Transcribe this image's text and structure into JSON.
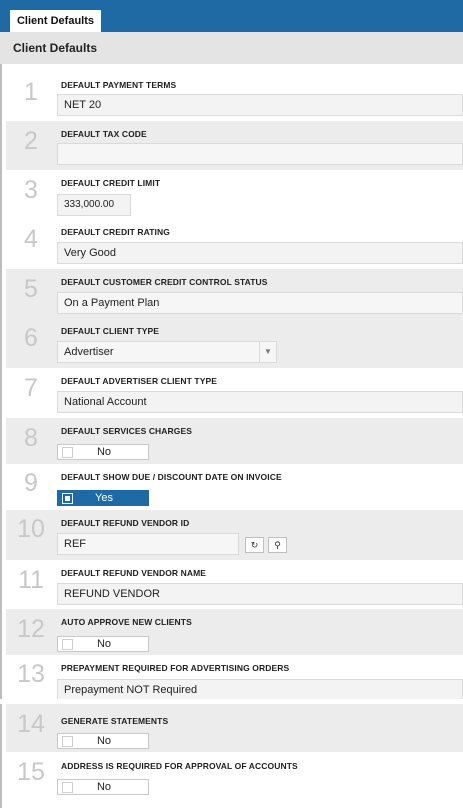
{
  "tab": {
    "label": "Client Defaults"
  },
  "header": {
    "title": "Client Defaults"
  },
  "rows": [
    {
      "number": "1",
      "label": "DEFAULT PAYMENT TERMS",
      "value": "NET 20"
    },
    {
      "number": "2",
      "label": "DEFAULT TAX CODE",
      "value": ""
    },
    {
      "number": "3",
      "label": "DEFAULT CREDIT LIMIT",
      "value": "333,000.00"
    },
    {
      "number": "4",
      "label": "DEFAULT CREDIT RATING",
      "value": "Very Good"
    },
    {
      "number": "5",
      "label": "DEFAULT CUSTOMER CREDIT CONTROL STATUS",
      "value": "On a Payment Plan"
    },
    {
      "number": "6",
      "label": "DEFAULT CLIENT TYPE",
      "value": "Advertiser"
    },
    {
      "number": "7",
      "label": "DEFAULT ADVERTISER CLIENT TYPE",
      "value": "National Account"
    },
    {
      "number": "8",
      "label": "DEFAULT SERVICES CHARGES",
      "value": "No"
    },
    {
      "number": "9",
      "label": "DEFAULT SHOW DUE / DISCOUNT DATE ON INVOICE",
      "value": "Yes"
    },
    {
      "number": "10",
      "label": "DEFAULT REFUND VENDOR ID",
      "value": "REF"
    },
    {
      "number": "11",
      "label": "DEFAULT REFUND VENDOR NAME",
      "value": "REFUND VENDOR"
    },
    {
      "number": "12",
      "label": "AUTO APPROVE NEW CLIENTS",
      "value": "No"
    },
    {
      "number": "13",
      "label": "PREPAYMENT REQUIRED FOR ADVERTISING ORDERS",
      "value": "Prepayment NOT Required"
    },
    {
      "number": "14",
      "label": "GENERATE STATEMENTS",
      "value": "No"
    },
    {
      "number": "15",
      "label": "ADDRESS IS REQUIRED FOR APPROVAL OF ACCOUNTS",
      "value": "No"
    }
  ],
  "icons": {
    "dropdown": "chevron-down-icon",
    "clear": "refresh-icon",
    "search": "search-icon"
  },
  "colors": {
    "accent": "#1f6aa5",
    "header_bg": "#e4e4e4",
    "row_alt": "#ececec"
  }
}
